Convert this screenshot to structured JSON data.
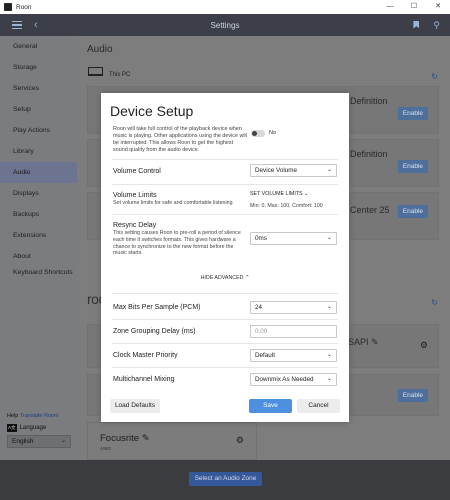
{
  "window": {
    "app_title": "Roon",
    "min": "—",
    "max": "☐",
    "close": "✕"
  },
  "header": {
    "title": "Settings"
  },
  "sidebar": {
    "items": [
      {
        "label": "General"
      },
      {
        "label": "Storage"
      },
      {
        "label": "Services"
      },
      {
        "label": "Setup"
      },
      {
        "label": "Play Actions"
      },
      {
        "label": "Library"
      },
      {
        "label": "Audio",
        "active": true
      },
      {
        "label": "Displays"
      },
      {
        "label": "Backups"
      },
      {
        "label": "Extensions"
      },
      {
        "label": "About"
      },
      {
        "label": "Keyboard Shortcuts"
      }
    ],
    "help_prefix": "Help",
    "help_link": "Translate Roon!",
    "language_label": "Language",
    "language_icon": "A文",
    "language_value": "English"
  },
  "main": {
    "title": "Audio",
    "this_pc": "This PC",
    "cards": [
      {
        "text": "Definition",
        "button": "Enable"
      },
      {
        "text": "Definition",
        "button": "Enable"
      },
      {
        "text": "Center 25",
        "button": "Enable"
      }
    ],
    "roon_heading": "roo",
    "asio_card": {
      "text": "SAPI ✎"
    },
    "focusrite": {
      "name": "Focusrite ✎",
      "sub": "ASIO"
    }
  },
  "footer": {
    "zone_button": "Select an Audio Zone"
  },
  "modal": {
    "title": "Device Setup",
    "description": "Roon will take full control of the playback device when music is playing. Other applications using the device will be interrupted. This allows Roon to get the highest sound quality from the audio device.",
    "exclusive_toggle": "No",
    "volume_control": {
      "label": "Volume Control",
      "value": "Device Volume"
    },
    "volume_limits": {
      "label": "Volume Limits",
      "sub": "Set volume limits for safe and comfortable listening",
      "link": "SET VOLUME LIMITS ⌄",
      "values": "Min: 0, Max: 100, Comfort: 100"
    },
    "resync": {
      "label": "Resync Delay",
      "sub": "This setting causes Roon to pre-roll a period of silence each time it switches formats. This gives hardware a chance to synchronize to the new format before the music starts.",
      "value": "0ms"
    },
    "hide_advanced": "HIDE ADVANCED ⌃",
    "max_bits": {
      "label": "Max Bits Per Sample (PCM)",
      "value": "24"
    },
    "zone_grouping": {
      "label": "Zone Grouping Delay (ms)",
      "placeholder": "0.00"
    },
    "clock_master": {
      "label": "Clock Master Priority",
      "value": "Default"
    },
    "multichannel": {
      "label": "Multichannel Mixing",
      "value": "Downmix As Needed"
    },
    "buttons": {
      "load_defaults": "Load Defaults",
      "save": "Save",
      "cancel": "Cancel"
    }
  }
}
